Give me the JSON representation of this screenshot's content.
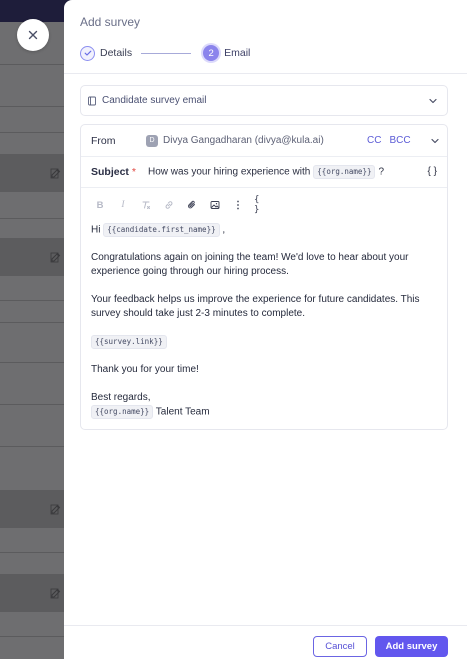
{
  "colors": {
    "accent": "#6257ee",
    "accent_text": "#5b5bd6",
    "required": "#e0463f",
    "backdrop": "#6e6e70"
  },
  "close": {
    "icon": "close-icon"
  },
  "drawer": {
    "title": "Add survey",
    "steps": [
      {
        "label": "Details",
        "status": "completed",
        "icon": "check-icon"
      },
      {
        "label": "Email",
        "number": "2",
        "status": "active"
      }
    ]
  },
  "template": {
    "selected": "Candidate survey email",
    "icon": "document-icon"
  },
  "email": {
    "from_label": "From",
    "sender_initial": "D",
    "sender": "Divya Gangadharan (divya@kula.ai)",
    "cc": "CC",
    "bcc": "BCC",
    "subject_label": "Subject",
    "subject_required": "*",
    "subject_text": "How was your hiring experience with",
    "subject_variable": "{{org.name}}",
    "subject_suffix": "?",
    "subject_braces": "{ }",
    "toolbar": {
      "bold": "B",
      "italic": "I",
      "more": "⋮",
      "variables": "{ }",
      "icons": [
        "bold-icon",
        "italic-icon",
        "clear-format-icon",
        "link-icon",
        "attachment-icon",
        "image-icon",
        "more-icon",
        "variable-icon"
      ]
    },
    "body": {
      "greeting": "Hi",
      "greeting_variable": "{{candidate.first_name}}",
      "greeting_suffix": ",",
      "paragraph_1": "Congratulations again on joining the team! We'd love to hear about your experience going through our hiring process.",
      "paragraph_2": "Your feedback helps us improve the experience for future candidates. This survey should take just 2-3 minutes to complete.",
      "survey_link_variable": "{{survey.link}}",
      "thanks": "Thank you for your time!",
      "signoff": "Best regards,",
      "signature_variable": "{{org.name}}",
      "signature_suffix": "Talent Team"
    }
  },
  "footer": {
    "cancel": "Cancel",
    "submit": "Add survey"
  }
}
